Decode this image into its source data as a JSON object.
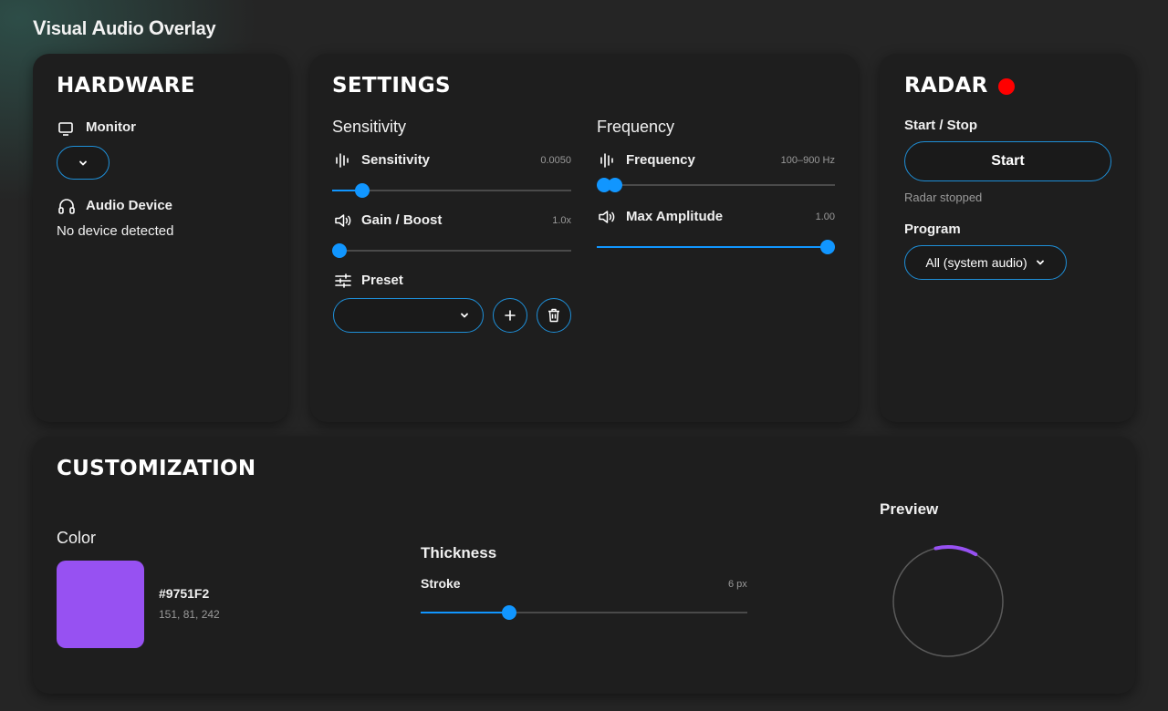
{
  "app": {
    "title_parts": [
      "V",
      "isual ",
      "A",
      "udio ",
      "O",
      "verlay"
    ]
  },
  "hardware": {
    "title": "HARDWARE",
    "monitor_label": "Monitor",
    "monitor_value": "",
    "audio_label": "Audio Device",
    "audio_value": "No device detected"
  },
  "settings": {
    "title": "SETTINGS",
    "sensitivity_section": "Sensitivity",
    "frequency_section": "Frequency",
    "sensitivity": {
      "label": "Sensitivity",
      "value": "0.0050",
      "fraction": 0.125
    },
    "gain": {
      "label": "Gain / Boost",
      "value": "1.0x",
      "fraction": 0.03
    },
    "preset": {
      "label": "Preset",
      "value": ""
    },
    "frequency": {
      "label": "Frequency",
      "value": "100–900 Hz",
      "low_fraction": 0.03,
      "high_fraction": 0.075
    },
    "amplitude": {
      "label": "Max Amplitude",
      "value": "1.00",
      "fraction": 0.97
    }
  },
  "radar": {
    "title": "RADAR",
    "start_stop_label": "Start / Stop",
    "start_button": "Start",
    "status": "Radar stopped",
    "program_label": "Program",
    "program_value": "All (system audio)",
    "indicator_color": "#ff0000"
  },
  "customization": {
    "title": "CUSTOMIZATION",
    "color_label": "Color",
    "color_hex": "#9751F2",
    "color_rgb": "151, 81, 242",
    "thickness_label": "Thickness",
    "stroke_label": "Stroke",
    "stroke_value": "6 px",
    "stroke_fraction": 0.27,
    "preview_label": "Preview",
    "preview_arc_fraction": 0.12
  },
  "colors": {
    "accent": "#1196ff",
    "border": "#1e8fd8",
    "swatch": "#9751F2"
  }
}
